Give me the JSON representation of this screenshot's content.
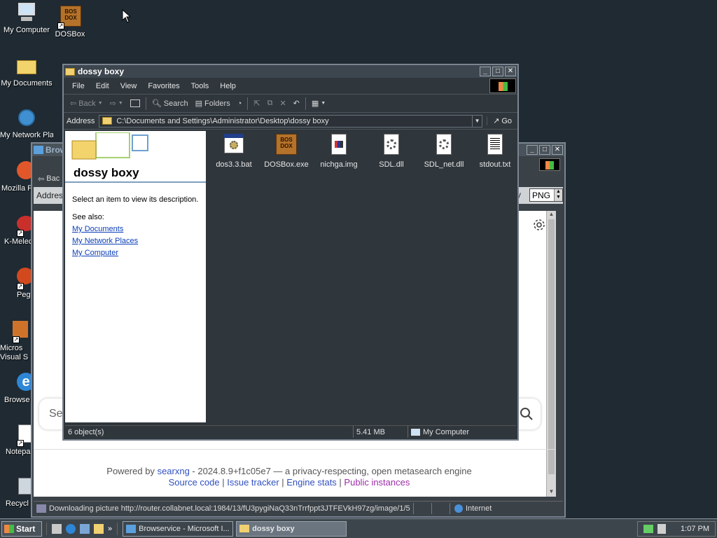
{
  "desktop": {
    "icons": [
      {
        "label": "My Computer"
      },
      {
        "label": "DOSBox"
      },
      {
        "label": "My Documents"
      },
      {
        "label": "My Network Plac"
      },
      {
        "label": "Mozilla F"
      },
      {
        "label": "K-Melec"
      },
      {
        "label": "Peg"
      },
      {
        "label": "Micros Visual S"
      },
      {
        "label": "Browse"
      },
      {
        "label": "Notepa"
      },
      {
        "label": "Recycl"
      }
    ]
  },
  "browser": {
    "title": "Brow",
    "back_label": "Bac",
    "address_label": "Addres",
    "format_label": "y",
    "format_value": "PNG",
    "search_placeholder": "Se",
    "footer": {
      "powered_by": "Powered by",
      "engine_name": "searxng",
      "engine_rest": " - 2024.8.9+f1c05e7 — a privacy-respecting, open metasearch engine",
      "source_code": "Source code",
      "issue_tracker": "Issue tracker",
      "engine_stats": "Engine stats",
      "public_instances": "Public instances",
      "sep": " | "
    },
    "status_text": "Downloading picture http://router.collabnet.local:1984/13/fU3pygiNaQ33nTrrfppt3JTFEVkH97zg/image/1/5",
    "status_zone": "Internet"
  },
  "explorer": {
    "title": "dossy boxy",
    "menu": [
      "File",
      "Edit",
      "View",
      "Favorites",
      "Tools",
      "Help"
    ],
    "toolbar": {
      "back": "Back",
      "search": "Search",
      "folders": "Folders"
    },
    "address_label": "Address",
    "address_value": "C:\\Documents and Settings\\Administrator\\Desktop\\dossy boxy",
    "go_label": "Go",
    "taskpane": {
      "folder_title": "dossy boxy",
      "description": "Select an item to view its description.",
      "see_also": "See also:",
      "links": [
        "My Documents",
        "My Network Places",
        "My Computer"
      ]
    },
    "files": [
      {
        "name": "dos3.3.bat",
        "icon": "batch-file-icon"
      },
      {
        "name": "DOSBox.exe",
        "icon": "dosbox-icon"
      },
      {
        "name": "nichga.img",
        "icon": "image-file-icon"
      },
      {
        "name": "SDL.dll",
        "icon": "dll-file-icon"
      },
      {
        "name": "SDL_net.dll",
        "icon": "dll-file-icon"
      },
      {
        "name": "stdout.txt",
        "icon": "text-file-icon"
      }
    ],
    "status": {
      "count": "6 object(s)",
      "size": "5.41 MB",
      "location": "My Computer"
    }
  },
  "taskbar": {
    "start_label": "Start",
    "tasks": [
      {
        "label": "Browservice - Microsoft I..."
      },
      {
        "label": "dossy boxy"
      }
    ],
    "clock": "1:07 PM",
    "chevron": "»"
  }
}
